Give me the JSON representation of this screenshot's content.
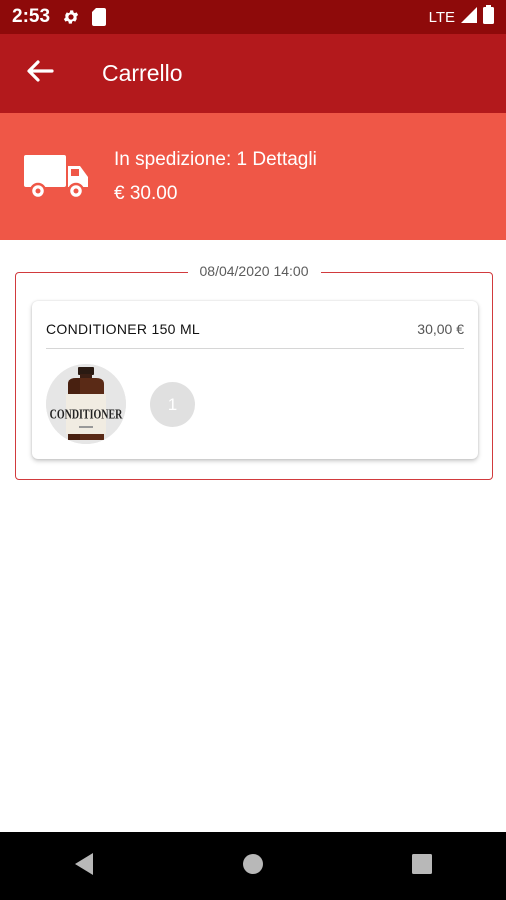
{
  "status_bar": {
    "time": "2:53",
    "network": "LTE",
    "icons": [
      "settings-icon",
      "sd-card-icon",
      "signal-icon",
      "battery-icon"
    ]
  },
  "app_bar": {
    "title": "Carrello",
    "back_icon": "arrow-left-icon"
  },
  "shipping": {
    "label": "In spedizione: 1 Dettagli",
    "total": "€ 30.00",
    "icon": "truck-icon"
  },
  "order": {
    "date": "08/04/2020 14:00",
    "items": [
      {
        "name": "CONDITIONER 150 ML",
        "price": "30,00 €",
        "quantity": "1",
        "bottle_label": "CONDITIONER"
      }
    ]
  },
  "nav": {
    "buttons": [
      "back-triangle-icon",
      "home-circle-icon",
      "recents-square-icon"
    ]
  },
  "colors": {
    "status_bar": "#8e0a0a",
    "app_bar": "#b3191c",
    "banner": "#ef5747",
    "order_border": "#d13a3d"
  }
}
